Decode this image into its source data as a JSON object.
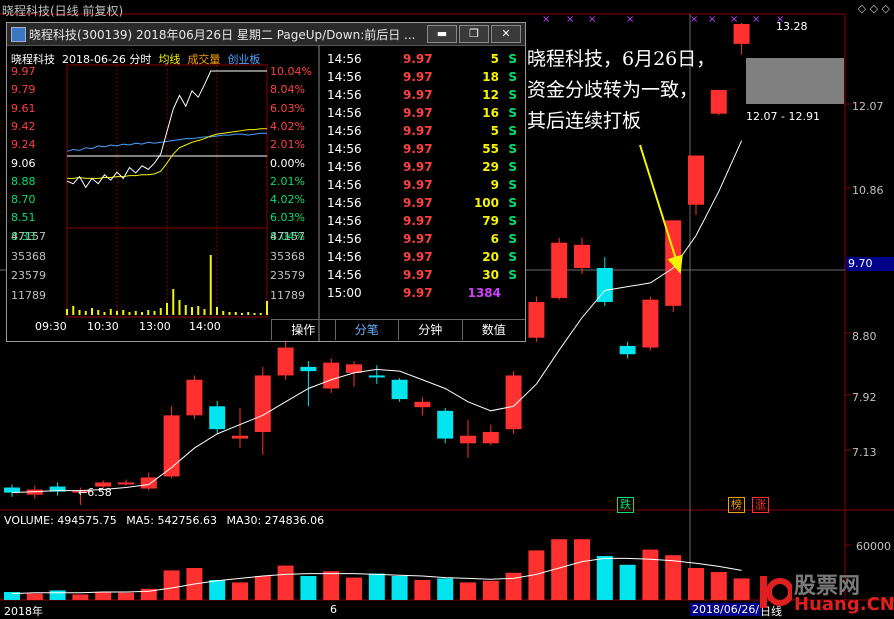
{
  "window": {
    "title": "晓程科技(日线 前复权)",
    "top_right_icons": "◇ ◇ ◇"
  },
  "price_axis": {
    "ticks": [
      "13.28",
      "12.07",
      "10.86",
      "9.70",
      "8.80",
      "7.92",
      "7.13"
    ],
    "marker_value": "9.70",
    "latest_price": "13.28",
    "range_label": "12.07 - 12.91",
    "low_label": "←6.58"
  },
  "event_badges": [
    {
      "text": "跌",
      "color": "#00e070"
    },
    {
      "text": "榜",
      "color": "#f0a000"
    },
    {
      "text": "涨",
      "color": "#ff3030"
    }
  ],
  "annotation": {
    "lines": [
      "晓程科技，6月26日，",
      "资金分歧转为一致，",
      "其后连续打板"
    ]
  },
  "popup": {
    "title": "晓程科技(300139) 2018年06月26日 星期二 PageUp/Down:前后日 ...",
    "buttons": {
      "minimize": "▬",
      "restore": "❐",
      "close": "✕"
    },
    "mini_header": {
      "name": "晓程科技",
      "date": "2018-06-26 分时",
      "avg": "均线",
      "vol": "成交量",
      "gem": "创业板"
    },
    "left_ticks": [
      {
        "text": "9.97",
        "color": "#ff4040"
      },
      {
        "text": "9.79",
        "color": "#ff4040"
      },
      {
        "text": "9.61",
        "color": "#ff4040"
      },
      {
        "text": "9.42",
        "color": "#ff4040"
      },
      {
        "text": "9.24",
        "color": "#ff4040"
      },
      {
        "text": "9.06",
        "color": "#ffffff"
      },
      {
        "text": "8.88",
        "color": "#00e070"
      },
      {
        "text": "8.70",
        "color": "#00e070"
      },
      {
        "text": "8.51",
        "color": "#00e070"
      },
      {
        "text": "8.33",
        "color": "#00e070"
      }
    ],
    "right_ticks": [
      {
        "text": "10.04%",
        "color": "#ff4040"
      },
      {
        "text": "8.04%",
        "color": "#ff4040"
      },
      {
        "text": "6.03%",
        "color": "#ff4040"
      },
      {
        "text": "4.02%",
        "color": "#ff4040"
      },
      {
        "text": "2.01%",
        "color": "#ff4040"
      },
      {
        "text": "0.00%",
        "color": "#ffffff"
      },
      {
        "text": "2.01%",
        "color": "#00e070"
      },
      {
        "text": "4.02%",
        "color": "#00e070"
      },
      {
        "text": "6.03%",
        "color": "#00e070"
      },
      {
        "text": "8.04%",
        "color": "#00e070"
      }
    ],
    "vol_ticks": [
      "47157",
      "35368",
      "23579",
      "11789"
    ],
    "x_ticks": [
      "09:30",
      "10:30",
      "13:00",
      "14:00"
    ],
    "ticks": [
      {
        "time": "14:56",
        "price": "9.97",
        "vol": "5",
        "side": "S"
      },
      {
        "time": "14:56",
        "price": "9.97",
        "vol": "18",
        "side": "S"
      },
      {
        "time": "14:56",
        "price": "9.97",
        "vol": "12",
        "side": "S"
      },
      {
        "time": "14:56",
        "price": "9.97",
        "vol": "16",
        "side": "S"
      },
      {
        "time": "14:56",
        "price": "9.97",
        "vol": "5",
        "side": "S"
      },
      {
        "time": "14:56",
        "price": "9.97",
        "vol": "55",
        "side": "S"
      },
      {
        "time": "14:56",
        "price": "9.97",
        "vol": "29",
        "side": "S"
      },
      {
        "time": "14:56",
        "price": "9.97",
        "vol": "9",
        "side": "S"
      },
      {
        "time": "14:56",
        "price": "9.97",
        "vol": "100",
        "side": "S"
      },
      {
        "time": "14:56",
        "price": "9.97",
        "vol": "79",
        "side": "S"
      },
      {
        "time": "14:56",
        "price": "9.97",
        "vol": "6",
        "side": "S"
      },
      {
        "time": "14:56",
        "price": "9.97",
        "vol": "20",
        "side": "S"
      },
      {
        "time": "14:56",
        "price": "9.97",
        "vol": "30",
        "side": "S"
      },
      {
        "time": "15:00",
        "price": "9.97",
        "vol": "1384",
        "side": ""
      }
    ],
    "tabs": [
      "操作",
      "分笔",
      "分钟",
      "数值"
    ],
    "active_tab_index": 1
  },
  "volume_panel": {
    "volume": "VOLUME: 494575.75",
    "ma5": "MA5: 542756.63",
    "ma30": "MA30: 274836.06",
    "axis_tick": "60000"
  },
  "x_axis": {
    "year": "2018年",
    "month": "6",
    "current_date": "2018/06/26/",
    "period": "日线"
  },
  "watermark": {
    "top": "股票网",
    "bottom": "Huang.CN"
  },
  "colors": {
    "up": "#ff3030",
    "down": "#00e5ee",
    "ma": "#ffffff",
    "grid": "#8b0000",
    "marker": "#00008b"
  },
  "chart_data": {
    "type": "candlestick",
    "candles": [
      {
        "open": 6.75,
        "close": 6.7,
        "high": 6.78,
        "low": 6.66
      },
      {
        "open": 6.68,
        "close": 6.73,
        "high": 6.77,
        "low": 6.64
      },
      {
        "open": 6.76,
        "close": 6.71,
        "high": 6.8,
        "low": 6.67
      },
      {
        "open": 6.72,
        "close": 6.72,
        "high": 6.75,
        "low": 6.58
      },
      {
        "open": 6.76,
        "close": 6.8,
        "high": 6.82,
        "low": 6.74
      },
      {
        "open": 6.8,
        "close": 6.8,
        "high": 6.83,
        "low": 6.77
      },
      {
        "open": 6.74,
        "close": 6.85,
        "high": 6.9,
        "low": 6.72
      },
      {
        "open": 6.86,
        "close": 7.5,
        "high": 7.6,
        "low": 6.84
      },
      {
        "open": 7.5,
        "close": 7.9,
        "high": 7.95,
        "low": 7.46
      },
      {
        "open": 7.6,
        "close": 7.35,
        "high": 7.66,
        "low": 7.3
      },
      {
        "open": 7.25,
        "close": 7.28,
        "high": 7.58,
        "low": 7.15
      },
      {
        "open": 7.32,
        "close": 7.95,
        "high": 8.05,
        "low": 7.08
      },
      {
        "open": 7.95,
        "close": 8.28,
        "high": 8.5,
        "low": 7.9
      },
      {
        "open": 8.05,
        "close": 8.0,
        "high": 8.12,
        "low": 7.6
      },
      {
        "open": 7.8,
        "close": 8.1,
        "high": 8.15,
        "low": 7.75
      },
      {
        "open": 7.98,
        "close": 8.08,
        "high": 8.12,
        "low": 7.82
      },
      {
        "open": 7.95,
        "close": 7.93,
        "high": 8.07,
        "low": 7.85
      },
      {
        "open": 7.9,
        "close": 7.68,
        "high": 7.92,
        "low": 7.65
      },
      {
        "open": 7.59,
        "close": 7.65,
        "high": 7.7,
        "low": 7.5
      },
      {
        "open": 7.55,
        "close": 7.25,
        "high": 7.58,
        "low": 7.2
      },
      {
        "open": 7.2,
        "close": 7.28,
        "high": 7.45,
        "low": 7.05
      },
      {
        "open": 7.2,
        "close": 7.32,
        "high": 7.4,
        "low": 7.18
      },
      {
        "open": 7.35,
        "close": 7.95,
        "high": 8.0,
        "low": 7.3
      },
      {
        "open": 8.4,
        "close": 8.85,
        "high": 8.92,
        "low": 8.35
      },
      {
        "open": 8.9,
        "close": 9.65,
        "high": 9.72,
        "low": 8.88
      },
      {
        "open": 9.3,
        "close": 9.62,
        "high": 9.72,
        "low": 9.22
      },
      {
        "open": 9.3,
        "close": 8.85,
        "high": 9.45,
        "low": 8.8
      },
      {
        "open": 8.3,
        "close": 8.2,
        "high": 8.35,
        "low": 8.15
      },
      {
        "open": 8.28,
        "close": 8.88,
        "high": 8.92,
        "low": 8.25
      },
      {
        "open": 8.8,
        "close": 9.97,
        "high": 9.97,
        "low": 8.72
      },
      {
        "open": 10.2,
        "close": 10.96,
        "high": 10.96,
        "low": 10.05
      },
      {
        "open": 11.65,
        "close": 12.06,
        "high": 12.06,
        "low": 11.62
      },
      {
        "open": 12.9,
        "close": 13.28,
        "high": 13.3,
        "low": 12.7
      }
    ],
    "ma_line": [
      6.7,
      6.71,
      6.72,
      6.72,
      6.73,
      6.75,
      6.78,
      6.95,
      7.15,
      7.3,
      7.4,
      7.5,
      7.65,
      7.8,
      7.9,
      7.98,
      8.02,
      8.0,
      7.9,
      7.8,
      7.65,
      7.55,
      7.6,
      7.85,
      8.25,
      8.65,
      9.0,
      9.05,
      9.1,
      9.3,
      9.75,
      10.4,
      11.2
    ],
    "volumes": [
      0.1,
      0.08,
      0.12,
      0.07,
      0.1,
      0.09,
      0.14,
      0.37,
      0.4,
      0.25,
      0.22,
      0.3,
      0.43,
      0.3,
      0.36,
      0.28,
      0.33,
      0.3,
      0.25,
      0.27,
      0.22,
      0.24,
      0.34,
      0.62,
      0.76,
      0.76,
      0.55,
      0.44,
      0.63,
      0.56,
      0.4,
      0.35,
      0.27
    ],
    "vol_ma": [
      0.08,
      0.09,
      0.09,
      0.09,
      0.1,
      0.1,
      0.11,
      0.15,
      0.2,
      0.24,
      0.27,
      0.3,
      0.32,
      0.33,
      0.33,
      0.33,
      0.32,
      0.31,
      0.3,
      0.28,
      0.27,
      0.26,
      0.27,
      0.32,
      0.4,
      0.48,
      0.52,
      0.52,
      0.51,
      0.49,
      0.46,
      0.42,
      0.37
    ]
  }
}
